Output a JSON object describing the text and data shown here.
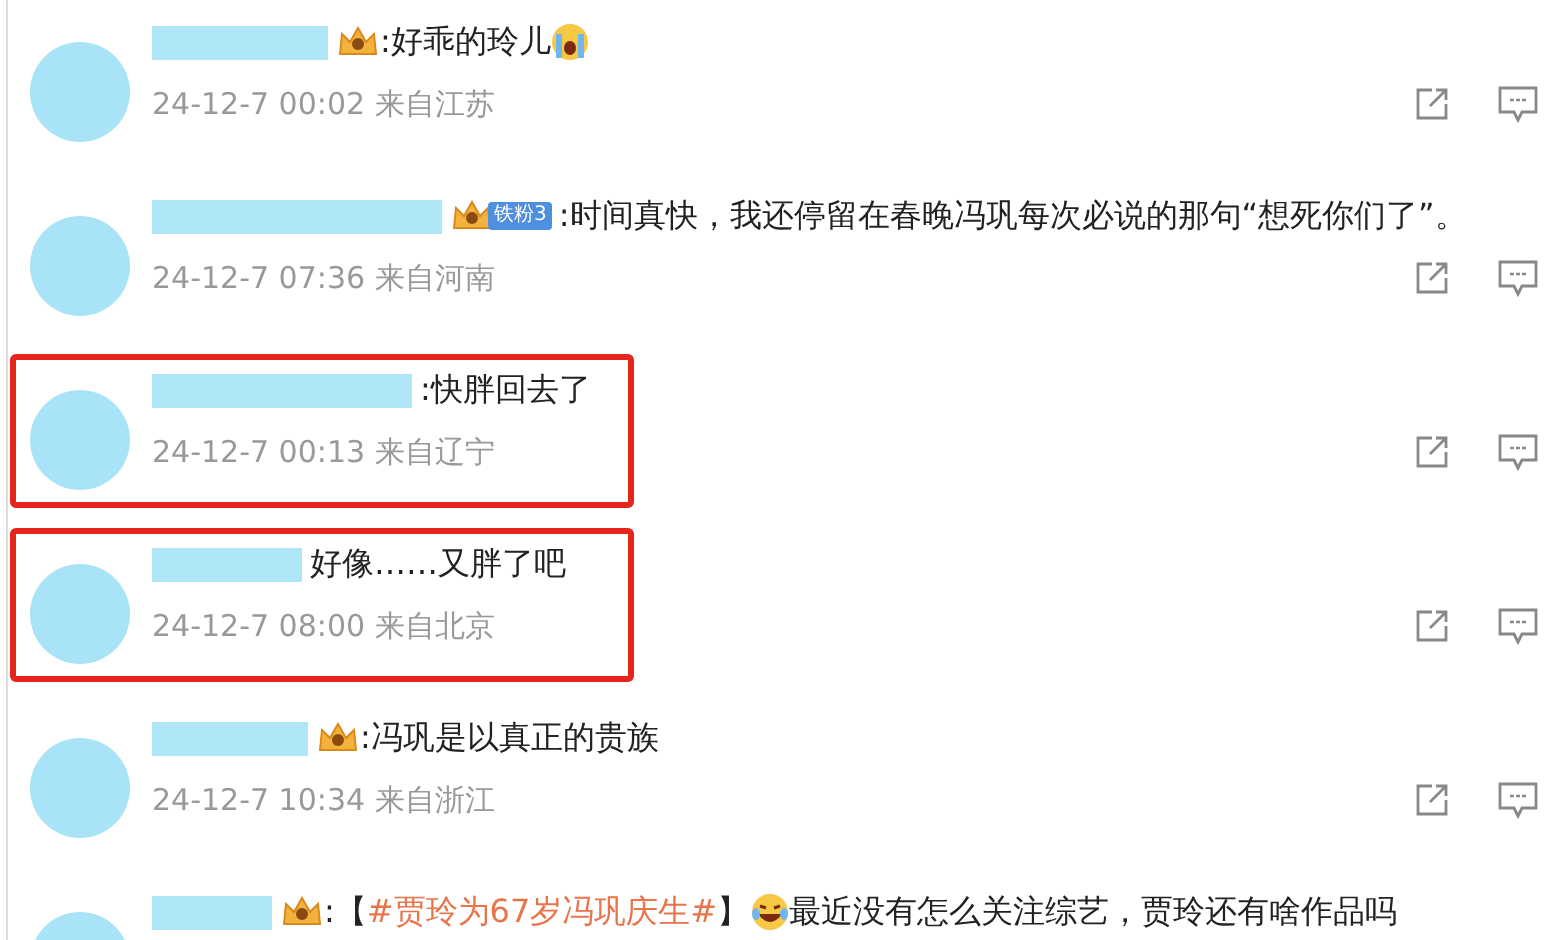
{
  "comments": [
    {
      "crown": true,
      "parts": [
        {
          "kind": "text",
          "text": ":好乖的玲儿"
        },
        {
          "kind": "emoji-crying"
        }
      ],
      "meta": "24-12-7 00:02 来自江苏",
      "highlighted": false,
      "actions": true
    },
    {
      "crown": true,
      "fan_level": "铁粉3",
      "parts": [
        {
          "kind": "text",
          "text": ":时间真快，我还停留在春晚冯巩每次必说的那句“想死你们了”。"
        }
      ],
      "meta": "24-12-7 07:36 来自河南",
      "highlighted": false,
      "actions": true
    },
    {
      "crown": false,
      "parts": [
        {
          "kind": "text",
          "text": ":快胖回去了"
        }
      ],
      "meta": "24-12-7 00:13 来自辽宁",
      "highlighted": true,
      "actions": true
    },
    {
      "crown": false,
      "parts": [
        {
          "kind": "text",
          "text": "好像……又胖了吧"
        }
      ],
      "meta": "24-12-7 08:00 来自北京",
      "highlighted": true,
      "actions": true
    },
    {
      "crown": true,
      "parts": [
        {
          "kind": "text",
          "text": ":冯巩是以真正的贵族"
        }
      ],
      "meta": "24-12-7 10:34 来自浙江",
      "highlighted": false,
      "actions": true
    },
    {
      "crown": true,
      "parts": [
        {
          "kind": "text",
          "text": ":【"
        },
        {
          "kind": "hashtag",
          "text": "#贾玲为67岁冯巩庆生#"
        },
        {
          "kind": "text",
          "text": "】"
        },
        {
          "kind": "emoji-laughing"
        },
        {
          "kind": "text",
          "text": "最近没有怎么关注综艺，贾玲还有啥作品吗"
        }
      ],
      "highlighted": false,
      "actions": false
    }
  ]
}
